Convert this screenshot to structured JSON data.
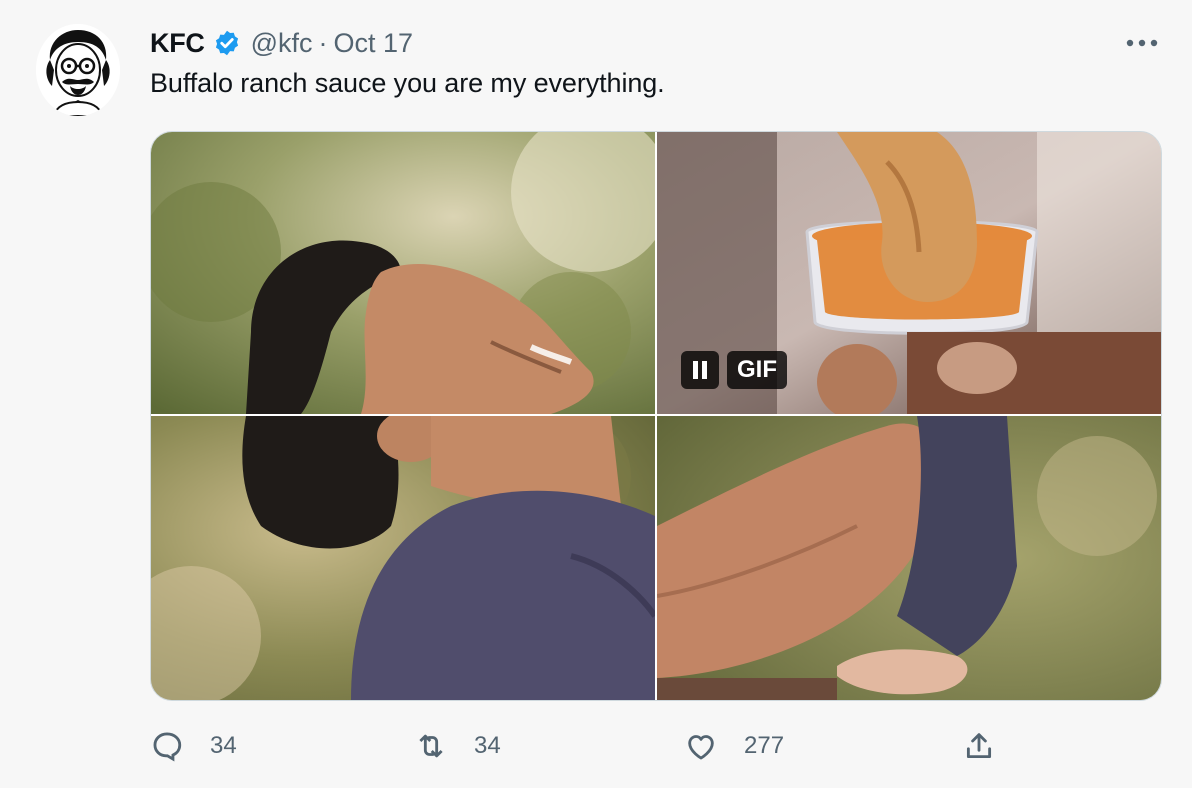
{
  "tweet": {
    "author_name": "KFC",
    "handle": "@kfc",
    "separator": "·",
    "date": "Oct 17",
    "text": "Buffalo ranch sauce you are my everything."
  },
  "media": {
    "gif_badge_label": "GIF"
  },
  "actions": {
    "reply_count": "34",
    "retweet_count": "34",
    "like_count": "277"
  },
  "colors": {
    "verified_blue": "#1d9bf0",
    "secondary_text": "#536471",
    "background": "#f7f7f7"
  }
}
